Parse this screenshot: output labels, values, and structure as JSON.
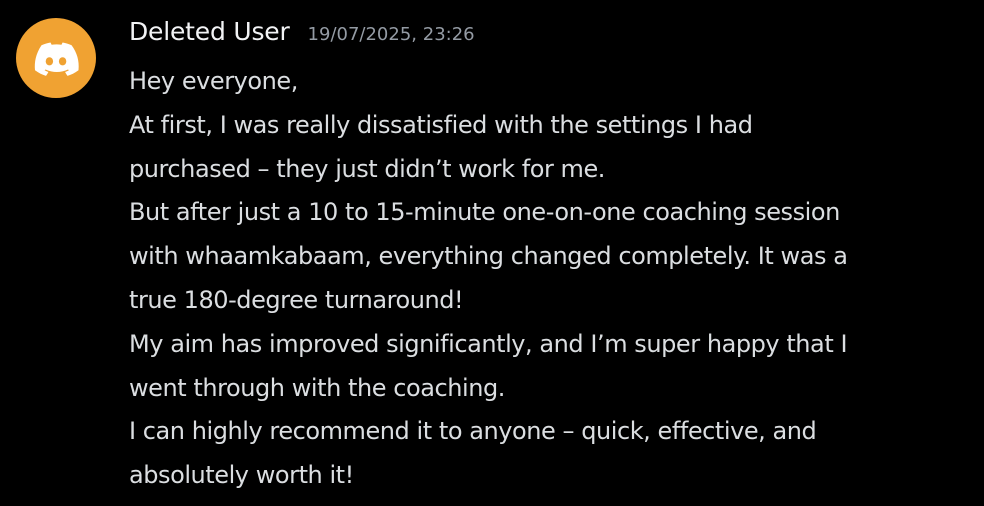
{
  "message": {
    "avatar_icon": "discord-logo-icon",
    "avatar_color": "#f0a232",
    "username": "Deleted User",
    "timestamp": "19/07/2025, 23:26",
    "lines": [
      "Hey everyone,",
      "At first, I was really dissatisfied with the settings I had",
      "purchased – they just didn’t work for me.",
      "But after just a 10 to 15-minute one-on-one coaching session",
      "with whaamkabaam, everything changed completely. It was a",
      "true 180-degree turnaround!",
      "My aim has improved significantly, and I’m super happy that I",
      "went through with the coaching.",
      "I can highly recommend it to anyone – quick, effective, and",
      "absolutely worth it!"
    ]
  }
}
